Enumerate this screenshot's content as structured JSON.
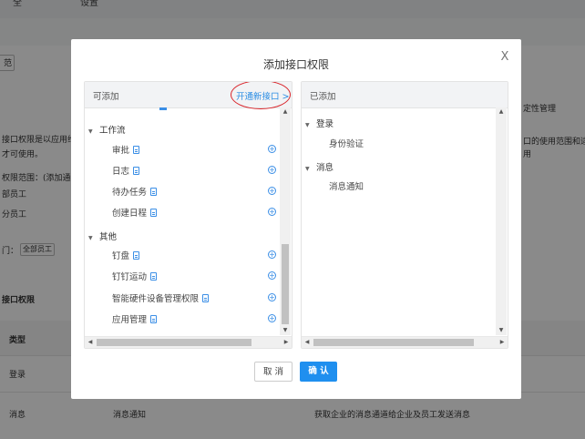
{
  "background": {
    "topbar": [
      "全",
      "设置"
    ],
    "button_label": "范",
    "paragraph_lines": [
      "接口权限是以应用维",
      "才可使用。"
    ],
    "scope_label": "权限范围：(添加通",
    "dept_items": [
      "部员工",
      "分员工"
    ],
    "dept_label": "门：",
    "dept_tag": "全部员工",
    "right_notes": [
      "定性管理",
      "口的使用范围和适",
      "用"
    ],
    "section_title": "接口权限",
    "col_type": "类型",
    "rows": [
      {
        "type": "登录",
        "name": "",
        "desc": ""
      },
      {
        "type": "消息",
        "name": "消息通知",
        "desc": "获取企业的消息通道给企业及员工发送消息"
      }
    ]
  },
  "dialog": {
    "title": "添加接口权限",
    "close": "X",
    "left_panel": {
      "label": "可添加",
      "open_link": "开通新接口",
      "open_link_arrow": ">",
      "groups": [
        {
          "label": "工作流",
          "items": [
            "审批",
            "日志",
            "待办任务",
            "创建日程"
          ]
        },
        {
          "label": "其他",
          "items": [
            "钉盘",
            "钉钉运动",
            "智能硬件设备管理权限",
            "应用管理"
          ]
        }
      ]
    },
    "right_panel": {
      "label": "已添加",
      "groups": [
        {
          "label": "登录",
          "items": [
            "身份验证"
          ]
        },
        {
          "label": "消息",
          "items": [
            "消息通知"
          ]
        }
      ]
    },
    "cancel": "取 消",
    "confirm": "确 认"
  },
  "colors": {
    "accent": "#1f8fef",
    "highlight_circle": "#d9262c"
  }
}
